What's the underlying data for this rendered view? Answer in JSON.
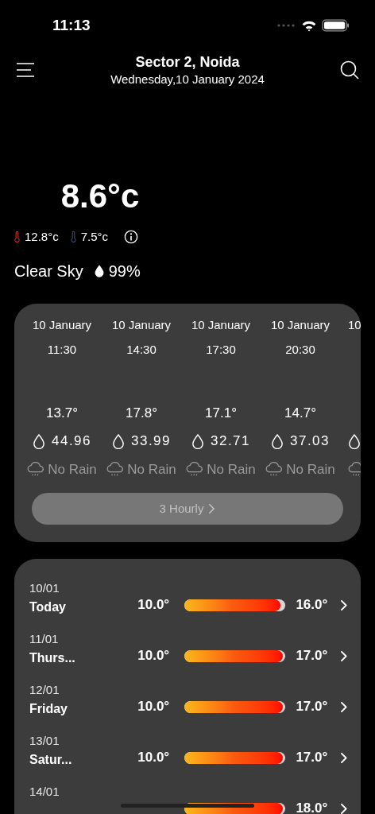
{
  "status_bar": {
    "time": "11:13"
  },
  "header": {
    "location": "Sector 2, Noida",
    "date": "Wednesday,10 January 2024"
  },
  "current": {
    "temperature": "8.6°c",
    "high": "12.8°c",
    "low": "7.5°c",
    "condition": "Clear Sky",
    "humidity": "99%"
  },
  "hourly": {
    "items": [
      {
        "date": "10 January",
        "time": "11:30",
        "temp": "13.7°",
        "humidity": "44.96",
        "rain": "No Rain"
      },
      {
        "date": "10 January",
        "time": "14:30",
        "temp": "17.8°",
        "humidity": "33.99",
        "rain": "No Rain"
      },
      {
        "date": "10 January",
        "time": "17:30",
        "temp": "17.1°",
        "humidity": "32.71",
        "rain": "No Rain"
      },
      {
        "date": "10 January",
        "time": "20:30",
        "temp": "14.7°",
        "humidity": "37.03",
        "rain": "No Rain"
      },
      {
        "date": "10"
      }
    ],
    "button": "3 Hourly"
  },
  "daily": [
    {
      "date": "10/01",
      "day": "Today",
      "min": "10.0°",
      "max": "16.0°",
      "level": 0.97
    },
    {
      "date": "11/01",
      "day": "Thurs...",
      "min": "10.0°",
      "max": "17.0°",
      "level": 1
    },
    {
      "date": "12/01",
      "day": "Friday",
      "min": "10.0°",
      "max": "17.0°",
      "level": 1
    },
    {
      "date": "13/01",
      "day": "Satur...",
      "min": "10.0°",
      "max": "17.0°",
      "level": 1
    },
    {
      "date": "14/01",
      "max": "18.0°",
      "level": 1
    }
  ]
}
